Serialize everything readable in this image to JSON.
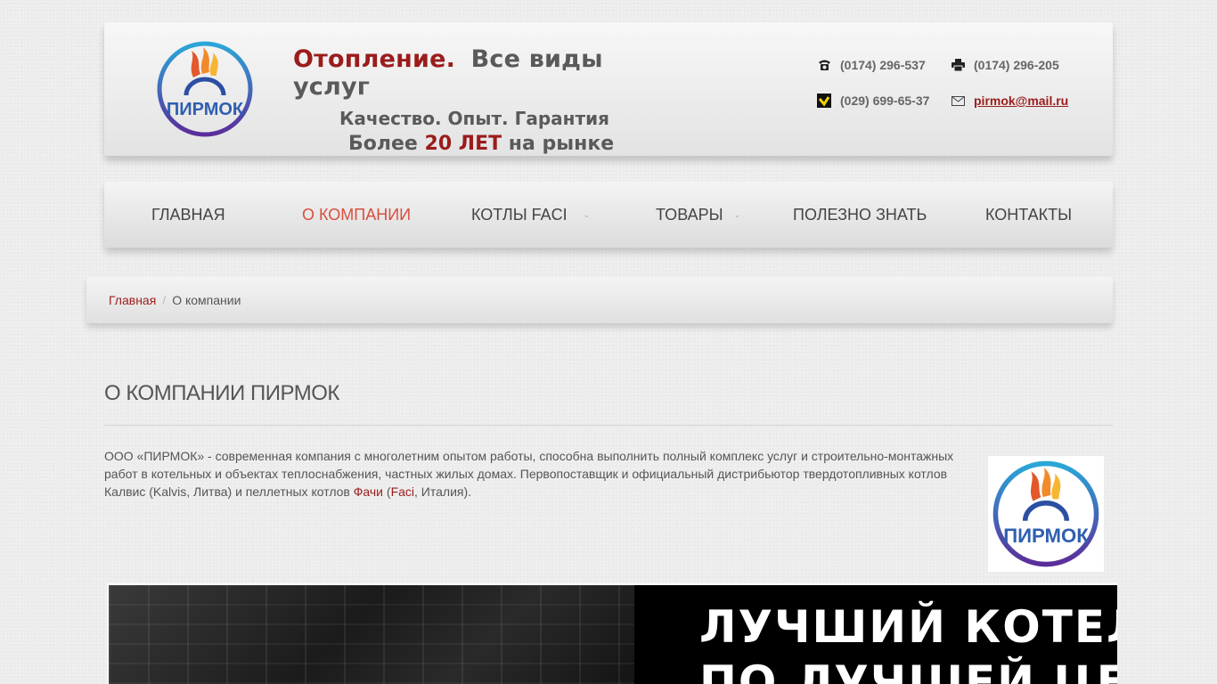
{
  "header": {
    "slogan": {
      "line1_red": "Отопление.",
      "line1_grey": "Все виды услуг",
      "line2": "Качество. Опыт. Гарантия",
      "line3_prefix": "Более",
      "line3_red": "20 ЛЕТ",
      "line3_suffix": "на рынке"
    },
    "logo_text": "ПИРМОК",
    "contacts": {
      "phone": "(0174) 296-537",
      "fax": "(0174) 296-205",
      "mobile": "(029) 699-65-37",
      "email": "pirmok@mail.ru"
    }
  },
  "nav": {
    "items": [
      {
        "label": "ГЛАВНАЯ"
      },
      {
        "label": "О КОМПАНИИ"
      },
      {
        "label": "КОТЛЫ FACI"
      },
      {
        "label": "ТОВАРЫ"
      },
      {
        "label": "ПОЛЕЗНО ЗНАТЬ"
      },
      {
        "label": "КОНТАКТЫ"
      }
    ],
    "caret": "⌄"
  },
  "breadcrumb": {
    "home": "Главная",
    "separator": "/",
    "current": "О компании"
  },
  "content": {
    "title": "О КОМПАНИИ ПИРМОК",
    "intro_part1": "ООО «ПИРМОК»  - современная компания с многолетним опытом работы, способна выполнить полный комплекс услуг и строительно-монтажных работ в котельных и объектах теплоснабжения, частных жилых домах. Первопоставщик и официальный дистрибьютор твердотопливных котлов Калвис (Kalvis, Литва) и пеллетных котлов ",
    "intro_link1": "Фачи",
    "intro_part2": " (",
    "intro_link2": "Faci",
    "intro_part3": ", Италия)."
  },
  "banner": {
    "line1": "ЛУЧШИЙ КОТЕЛ",
    "line2": "ПО ЛУЧШЕЙ ЦЕНЕ"
  },
  "colors": {
    "accent_red": "#9b1c1c",
    "nav_active": "#d84f3f",
    "logo_blue": "#2c6fb8"
  }
}
